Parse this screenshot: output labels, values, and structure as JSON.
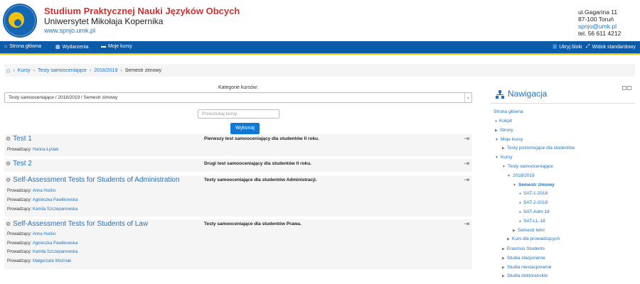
{
  "header": {
    "school": "Studium Praktycznej Nauki Języków Obcych",
    "university": "Uniwersytet Mikołaja Kopernika",
    "website": "www.spnjo.umk.pl",
    "address1": "ul.Gagarina 11",
    "address2": "87-100 Toruń",
    "email": "spnjo@umk.pl",
    "phone": "tel. 56 611 4212"
  },
  "nav": {
    "home": "Strona główna",
    "events": "Wydarzenia",
    "my_courses": "Moje kursy",
    "hide_blocks": "Ukryj bloki",
    "standard_view": "Widok standardowy"
  },
  "breadcrumb": [
    "Kursy",
    "Testy samooceniające",
    "2018/2019",
    "Semestr zimowy"
  ],
  "main": {
    "category_label": "Kategorie kursów:",
    "category_value": "Testy samooceniające / 2018/2019 / Semestr zimowy",
    "search_placeholder": "Przeszukaj kursy",
    "search_button": "Wykonaj",
    "teacher_label": "Prowadzący:",
    "courses": [
      {
        "title": "Test 1",
        "desc": "Pierwszy test samooceniający dla studentów II roku.",
        "teachers": [
          "Hanna Łysiak"
        ]
      },
      {
        "title": "Test 2",
        "desc": "Drugi test samooceniający dla studentów II roku.",
        "teachers": []
      },
      {
        "title": "Self-Assessment Tests for Students of Administration",
        "desc": "Testy samooceniające dla studentów Administracji.",
        "teachers": [
          "Anna Hućko",
          "Agnieszka Pawlikowska",
          "Kamila Szczepanowska"
        ]
      },
      {
        "title": "Self-Assessment Tests for Students of Law",
        "desc": "Testy samooceniające dla studentów Prawa.",
        "teachers": [
          "Anna Hućko",
          "Agnieszka Pawlikowska",
          "Kamila Szczepanowska",
          "Małgorzata Woźniak"
        ]
      }
    ]
  },
  "navblock": {
    "title": "Nawigacja",
    "items": [
      {
        "label": "Strona główna"
      },
      {
        "label": "Kokpit"
      },
      {
        "label": "Strony"
      },
      {
        "label": "Moje kursy"
      },
      {
        "label": "Testy poziomujące dla studentów"
      },
      {
        "label": "Kursy"
      },
      {
        "label": "Testy samooceniające"
      },
      {
        "label": "2018/2019"
      },
      {
        "label": "Semestr zimowy"
      },
      {
        "label": "SAT-1-2018"
      },
      {
        "label": "SAT-2-2018"
      },
      {
        "label": "SAT-Adm-18"
      },
      {
        "label": "SAT-LL-18"
      },
      {
        "label": "Semestr letni"
      },
      {
        "label": "Kurs dla prowadzących"
      },
      {
        "label": "Erasmus Students"
      },
      {
        "label": "Studia stacjonarne"
      },
      {
        "label": "Studia niestacjonarne"
      },
      {
        "label": "Studia doktoranckie"
      }
    ]
  }
}
